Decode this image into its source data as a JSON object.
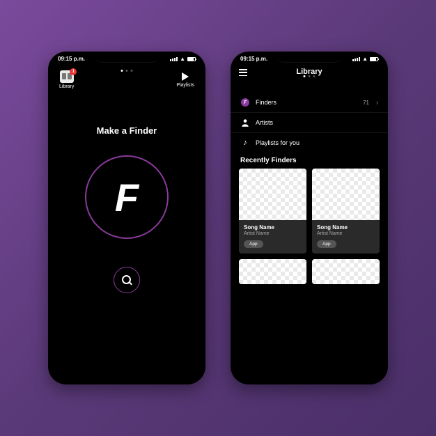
{
  "status": {
    "time": "09:15 p.m."
  },
  "screen1": {
    "library_label": "Library",
    "library_badge": "1",
    "playlists_label": "Playlists",
    "headline": "Make a Finder",
    "finder_glyph": "F"
  },
  "screen2": {
    "title": "Library",
    "rows": {
      "finders": {
        "label": "Finders",
        "count": "71"
      },
      "artists": {
        "label": "Artists"
      },
      "playlists": {
        "label": "Playlists for you"
      }
    },
    "section": "Recently Finders",
    "cards": [
      {
        "song": "Song Name",
        "artist": "Artist Name",
        "chip": "App"
      },
      {
        "song": "Song Name",
        "artist": "Artist Name",
        "chip": "App"
      }
    ]
  }
}
